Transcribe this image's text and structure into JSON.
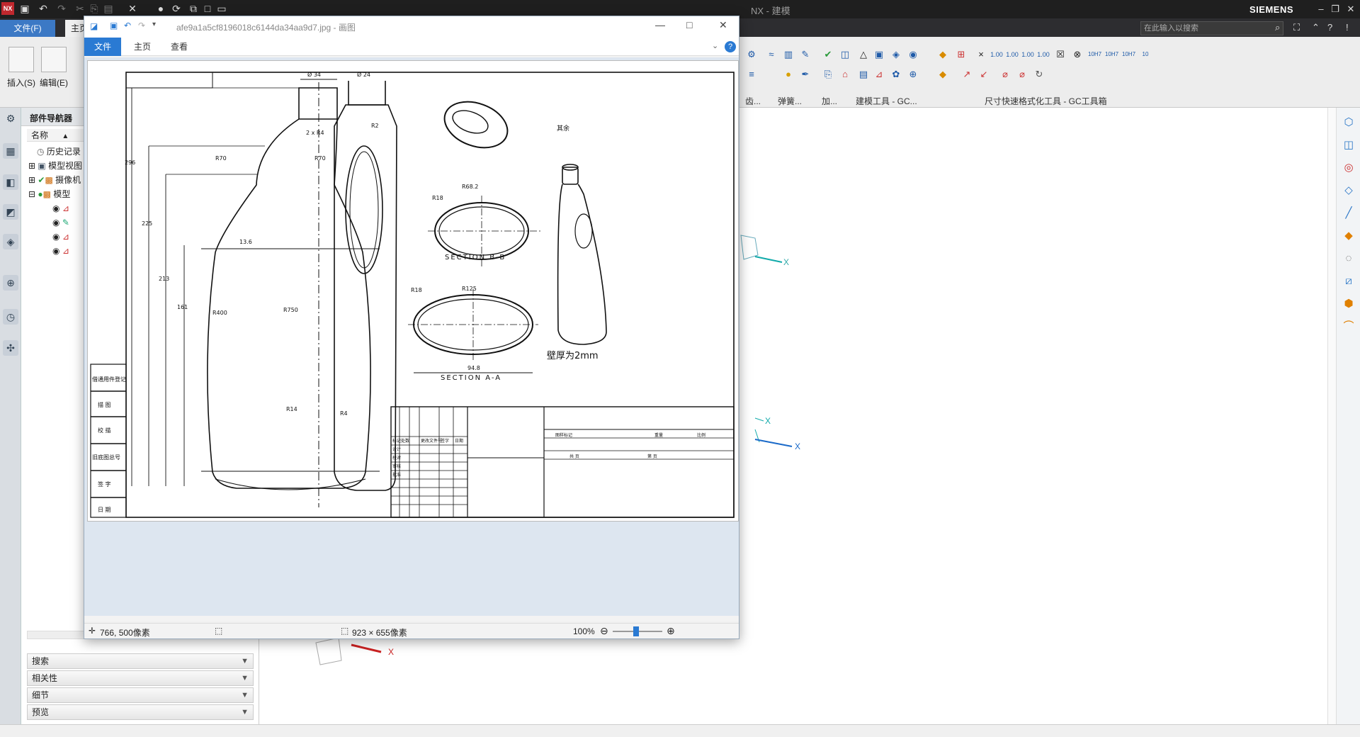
{
  "nx": {
    "title": "NX - 建模",
    "brand": "SIEMENS",
    "file_tab": "文件(F)",
    "home_tab": "主页",
    "search_placeholder": "在此输入以搜索",
    "insert_label": "插入(S)",
    "edit_label": "编辑(E)",
    "groups": [
      "齿...",
      "弹簧...",
      "加...",
      "建模工具 - GC...",
      "尺寸快速格式化工具 - GC工具箱"
    ]
  },
  "navigator": {
    "title": "部件导航器",
    "column": "名称",
    "items": [
      "历史记录",
      "模型视图",
      "摄像机",
      "模型"
    ],
    "sections": [
      "搜索",
      "相关性",
      "细节",
      "预览"
    ]
  },
  "viewer": {
    "title": "afe9a1a5cf8196018c6144da34aa9d7.jpg - 画图",
    "tabs": [
      "文件",
      "主页",
      "查看"
    ],
    "status": {
      "cursor": "766, 500像素",
      "size": "923 × 655像素",
      "zoom": "100%"
    }
  },
  "drawing": {
    "dims": [
      "Ø 34",
      "Ø 24",
      "2 x R4",
      "R70",
      "R70",
      "R2",
      "13.6",
      "R400",
      "R750",
      "R14",
      "R4",
      "R18",
      "R68.2",
      "R18",
      "R125",
      "94.8",
      "296",
      "225",
      "213",
      "161"
    ],
    "section_bb": "SECTION  B-B",
    "section_aa": "SECTION  A-A",
    "wall_note": "壁厚为2mm",
    "finish_note": "其余",
    "left_table": [
      "借通用件登记",
      "描  图",
      "校  描",
      "旧底图总号",
      "签  字",
      "日  期"
    ],
    "title_block": [
      "标记",
      "处数",
      "更改文件号",
      "签字",
      "日期",
      "设计",
      "校对",
      "审核",
      "批准",
      "图样标记",
      "重量",
      "比例",
      "共  页",
      "第  页"
    ]
  },
  "viewport": {
    "axis_label": "X"
  }
}
